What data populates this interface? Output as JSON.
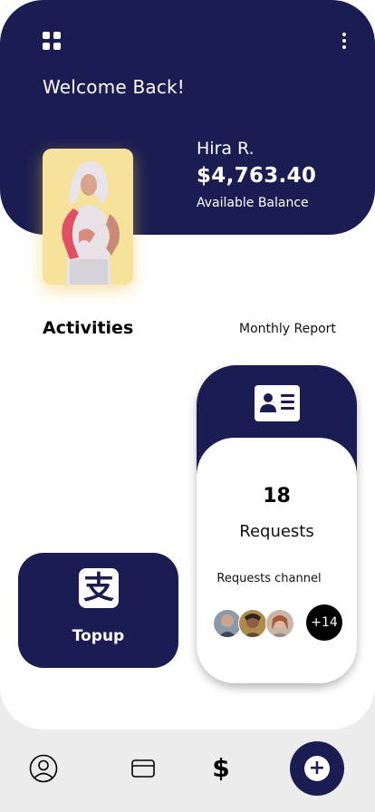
{
  "header": {
    "welcome": "Welcome Back!",
    "user_name": "Hira R.",
    "balance": "$4,763.40",
    "balance_label": "Available Balance"
  },
  "activities": {
    "title": "Activities",
    "report_link": "Monthly Report"
  },
  "topup": {
    "icon_glyph": "支",
    "label": "Topup"
  },
  "requests": {
    "count": "18",
    "label": "Requests",
    "channel_label": "Requests channel",
    "more_count": "+14"
  },
  "bottom_nav": {
    "dollar_glyph": "$",
    "add_glyph": "+"
  },
  "colors": {
    "primary": "#1b1c52",
    "photo_background": "#f6e29a",
    "nav_background": "#ececec"
  }
}
